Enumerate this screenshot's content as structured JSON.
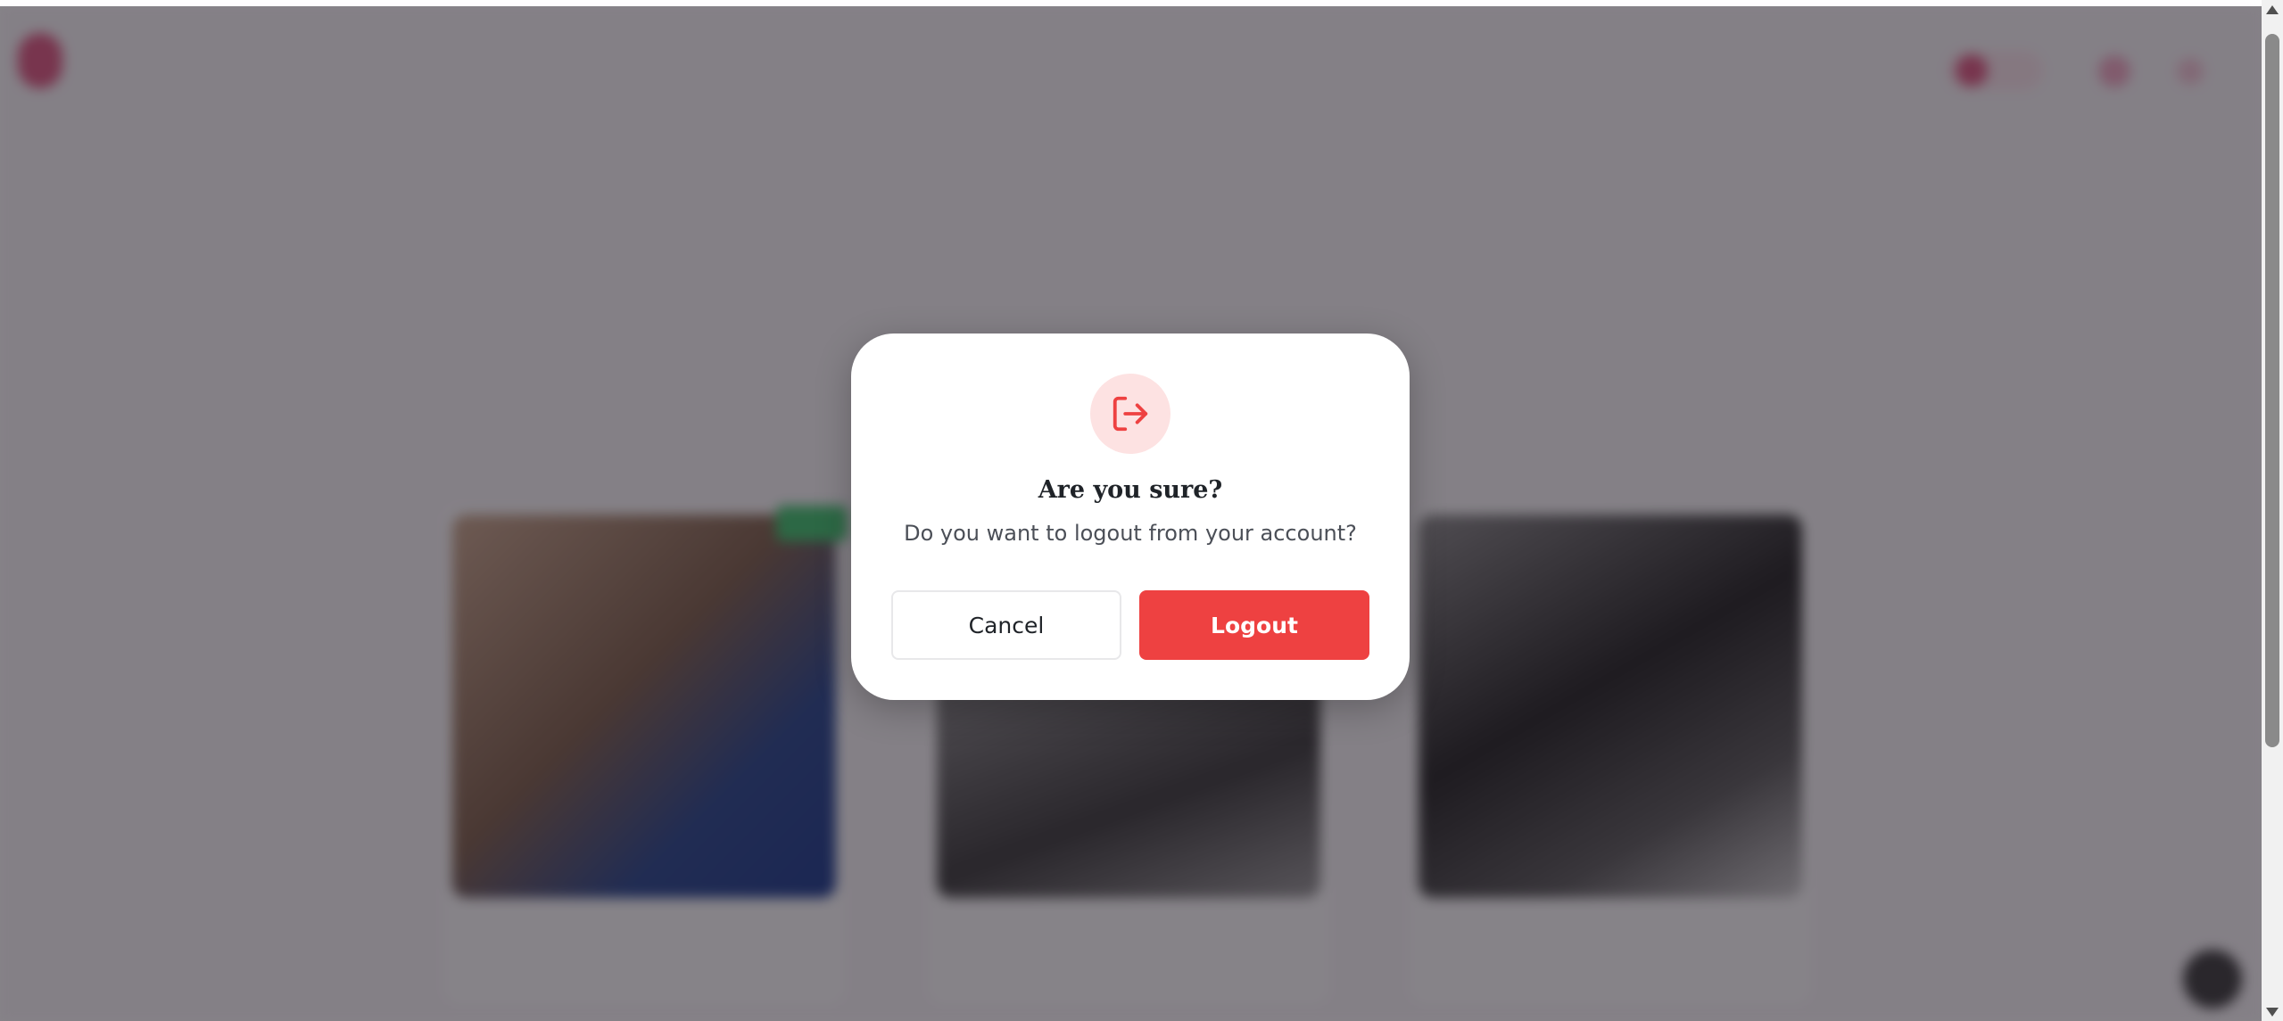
{
  "dialog": {
    "title": "Are you sure?",
    "message": "Do you want to logout from your account?",
    "cancel_label": "Cancel",
    "logout_label": "Logout",
    "icon": "logout-icon"
  },
  "colors": {
    "danger": "#ee4141",
    "danger_light": "#fde2e2",
    "overlay": "rgba(35,30,38,0.55)"
  }
}
